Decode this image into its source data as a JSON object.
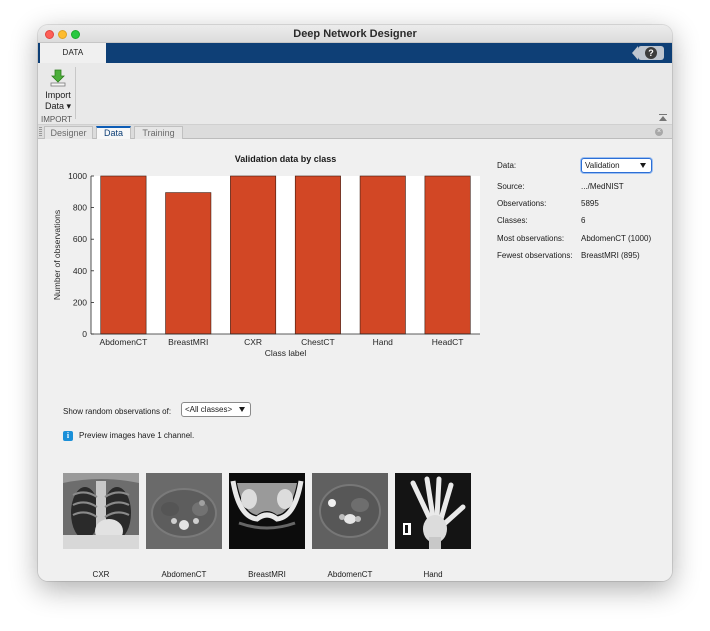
{
  "window": {
    "title": "Deep Network Designer"
  },
  "ribbon": {
    "tab": "DATA",
    "import_button": {
      "line1": "Import",
      "line2": "Data ▾"
    },
    "group_label": "IMPORT",
    "help_label": "?"
  },
  "doc_tabs": [
    {
      "label": "Designer"
    },
    {
      "label": "Data"
    },
    {
      "label": "Training"
    }
  ],
  "chart_data": {
    "type": "bar",
    "title": "Validation data by class",
    "xlabel": "Class label",
    "ylabel": "Number of observations",
    "categories": [
      "AbdomenCT",
      "BreastMRI",
      "CXR",
      "ChestCT",
      "Hand",
      "HeadCT"
    ],
    "values": [
      1000,
      895,
      1000,
      1000,
      1000,
      1000
    ],
    "ylim": [
      0,
      1000
    ],
    "yticks": [
      0,
      200,
      400,
      600,
      800,
      1000
    ],
    "bar_color": "#d24725",
    "grid": false,
    "legend": "none"
  },
  "info": {
    "data_label": "Data:",
    "data_value": "Validation",
    "rows": [
      {
        "key": "Source:",
        "value": ".../MedNIST"
      },
      {
        "key": "Observations:",
        "value": "5895"
      },
      {
        "key": "Classes:",
        "value": "6"
      },
      {
        "key": "Most observations:",
        "value": "AbdomenCT (1000)"
      },
      {
        "key": "Fewest observations:",
        "value": "BreastMRI (895)"
      }
    ]
  },
  "preview": {
    "show_label": "Show random observations of:",
    "filter_value": "<All classes>",
    "note": "Preview images have 1 channel.",
    "images": [
      {
        "label": "CXR"
      },
      {
        "label": "AbdomenCT"
      },
      {
        "label": "BreastMRI"
      },
      {
        "label": "AbdomenCT"
      },
      {
        "label": "Hand"
      }
    ]
  },
  "colors": {
    "accent": "#0e3f76",
    "bar": "#d24725",
    "info_icon": "#1a8fd8"
  }
}
